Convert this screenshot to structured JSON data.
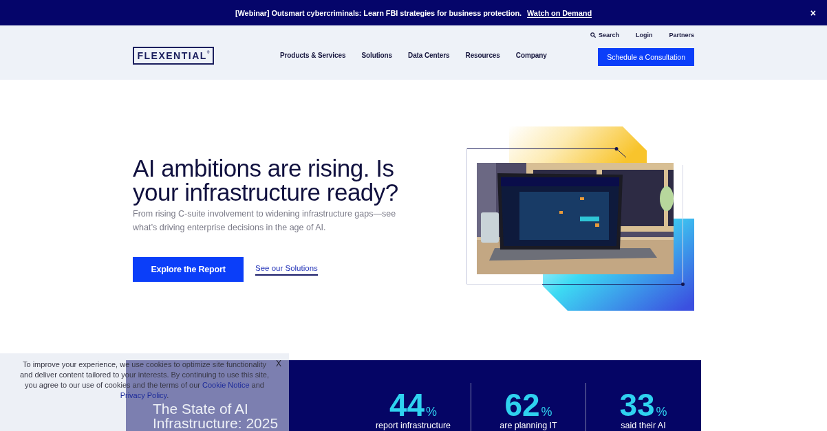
{
  "announcement_bar": {
    "text": "[Webinar] Outsmart cybercriminals: Learn FBI strategies for business protection.",
    "link": "Watch on Demand",
    "close": "×"
  },
  "header": {
    "logo": "FLEXENTIAL$^{®}$",
    "utility_links": [
      {
        "kind": "search",
        "label": "Search"
      },
      {
        "kind": "link",
        "label": "Login"
      },
      {
        "kind": "link",
        "label": "Partners"
      }
    ],
    "nav": [
      "Products & Services",
      "Solutions",
      "Data Centers",
      "Resources",
      "Company"
    ],
    "cta": "Schedule a Consultation"
  },
  "hero": {
    "title": "AI ambitions are rising. Is your infrastructure ready?",
    "subtitle": "From rising C-suite involvement to widening infrastructure gaps—see what’s driving enterprise decisions in the age of AI.",
    "primary_button": "Explore the Report",
    "secondary_link": "See our Solutions"
  },
  "report_section": {
    "title": "The State of AI Infrastructure: 2025",
    "stats": [
      {
        "value": "44",
        "unit": "%",
        "label": "report infrastructure"
      },
      {
        "value": "62",
        "unit": "%",
        "label": "are planning IT"
      },
      {
        "value": "33",
        "unit": "%",
        "label": "said their AI"
      }
    ]
  },
  "cookie_banner": {
    "segments": [
      {
        "kind": "text",
        "text": "To improve your experience, we use cookies to optimize site functionality and deliver content tailored to your interests. By continuing to use this site, you agree to our use of cookies and the terms of our "
      },
      {
        "kind": "link",
        "text": "Cookie Notice"
      },
      {
        "kind": "text",
        "text": " and "
      },
      {
        "kind": "link",
        "text": "Privacy Policy"
      },
      {
        "kind": "text",
        "text": "."
      }
    ],
    "close": "X"
  }
}
